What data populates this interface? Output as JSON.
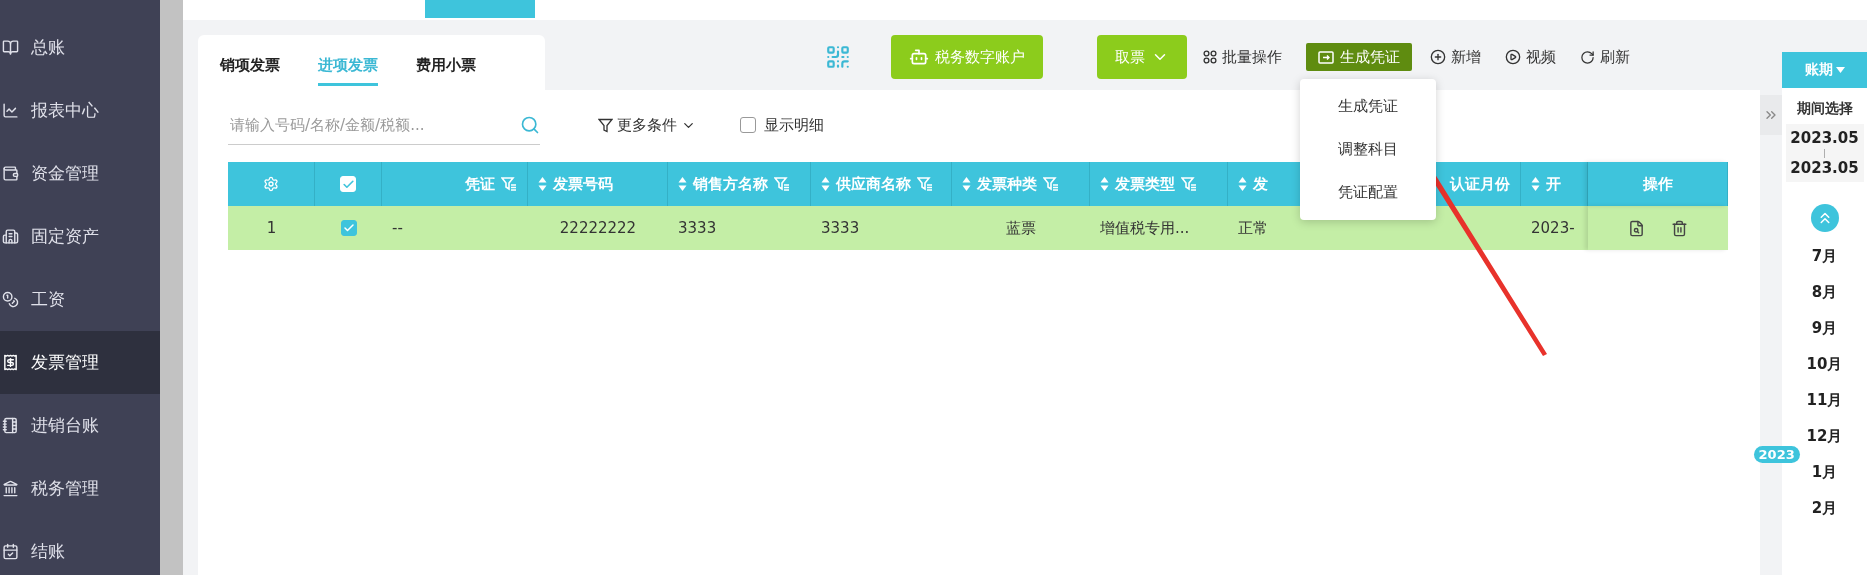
{
  "sidebar": {
    "items": [
      {
        "label": "总账",
        "selected": false
      },
      {
        "label": "报表中心",
        "selected": false
      },
      {
        "label": "资金管理",
        "selected": false
      },
      {
        "label": "固定资产",
        "selected": false
      },
      {
        "label": "工资",
        "selected": false
      },
      {
        "label": "发票管理",
        "selected": true
      },
      {
        "label": "进销台账",
        "selected": false
      },
      {
        "label": "税务管理",
        "selected": false
      },
      {
        "label": "结账",
        "selected": false
      }
    ]
  },
  "tabs": [
    {
      "label": "销项发票",
      "selected": false
    },
    {
      "label": "进项发票",
      "selected": true
    },
    {
      "label": "费用小票",
      "selected": false
    }
  ],
  "toolbar": [
    {
      "kind": "qr"
    },
    {
      "kind": "primary",
      "label": "税务数字账户"
    },
    {
      "kind": "primary-dropdown",
      "label": "取票"
    },
    {
      "kind": "link",
      "label": "批量操作"
    },
    {
      "kind": "active",
      "label": "生成凭证",
      "expanded": true
    },
    {
      "kind": "link",
      "label": "新增"
    },
    {
      "kind": "link",
      "label": "视频"
    },
    {
      "kind": "link",
      "label": "刷新"
    }
  ],
  "menu": {
    "items": [
      {
        "label": "生成凭证"
      },
      {
        "label": "调整科目"
      },
      {
        "label": "凭证配置"
      }
    ]
  },
  "search": {
    "placeholder": "请输入号码/名称/金额/税额..."
  },
  "more_conditions": {
    "label": "更多条件"
  },
  "show_detail": {
    "label": "显示明细",
    "checked": false
  },
  "table": {
    "columns": [
      {
        "kind": "settings"
      },
      {
        "kind": "check",
        "checked": true
      },
      {
        "kind": "text",
        "label": "凭证",
        "sortable": false,
        "filterable": true
      },
      {
        "kind": "text",
        "label": "发票号码",
        "sortable": true,
        "filterable": false
      },
      {
        "kind": "text",
        "label": "销售方名称",
        "sortable": true,
        "filterable": true
      },
      {
        "kind": "text",
        "label": "供应商名称",
        "sortable": true,
        "filterable": true
      },
      {
        "kind": "text",
        "label": "发票种类",
        "sortable": true,
        "filterable": true
      },
      {
        "kind": "text",
        "label": "发票类型",
        "sortable": true,
        "filterable": true
      },
      {
        "kind": "text",
        "label": "发",
        "sortable": true,
        "filterable": false
      },
      {
        "kind": "text",
        "label": "认证月份",
        "sortable": false,
        "filterable": false
      },
      {
        "kind": "text",
        "label": "开",
        "sortable": true,
        "filterable": false
      },
      {
        "kind": "actions",
        "label": "操作"
      }
    ],
    "rows": [
      {
        "selected": true,
        "checked": true,
        "cells": [
          "1",
          "",
          "--",
          "22222222",
          "3333",
          "3333",
          "蓝票",
          "增值税专用...",
          "正常",
          "",
          "2023-",
          ""
        ]
      }
    ]
  },
  "period": {
    "button": "账期",
    "title": "期间选择",
    "start": "2023.05",
    "separator": "|",
    "end": "2023.05",
    "months": [
      "7月",
      "8月",
      "9月",
      "10月",
      "11月",
      "12月",
      "1月",
      "2月"
    ],
    "year_badge": "2023"
  },
  "annotation": {
    "kind": "arrow"
  }
}
